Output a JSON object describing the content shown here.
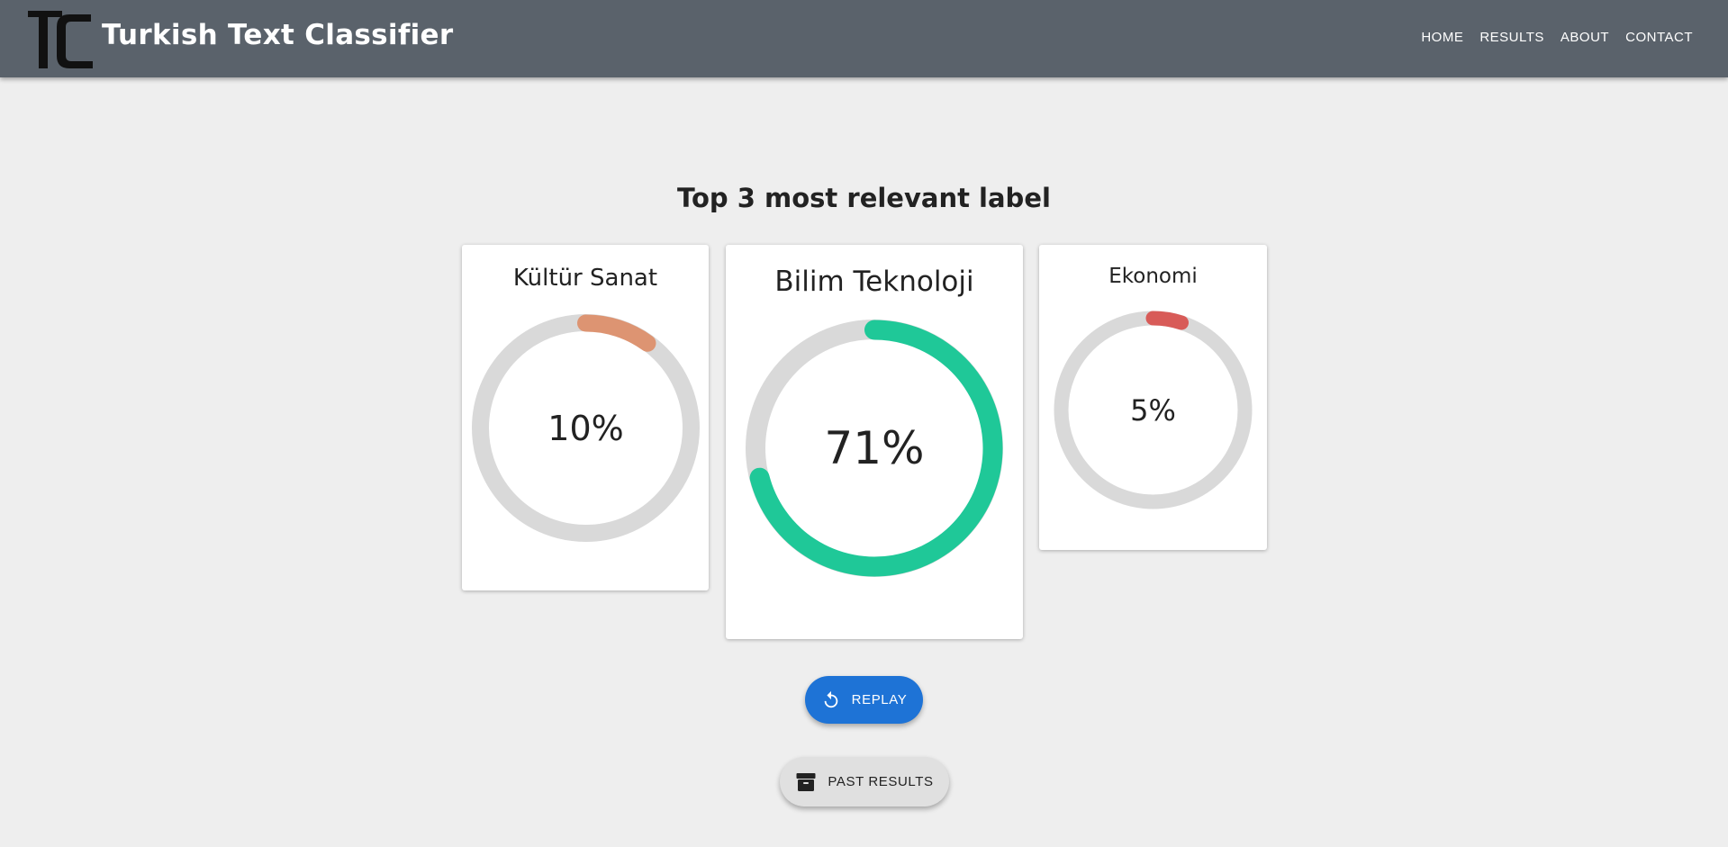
{
  "app": {
    "title": "Turkish Text Classifier",
    "logo_icon": "tc-monogram-icon"
  },
  "nav": {
    "items": [
      {
        "label": "HOME"
      },
      {
        "label": "RESULTS"
      },
      {
        "label": "ABOUT"
      },
      {
        "label": "CONTACT"
      }
    ]
  },
  "main": {
    "heading": "Top 3 most relevant label"
  },
  "results": [
    {
      "label": "Kültür Sanat",
      "value_text": "10%",
      "percent": 10,
      "color": "#dd9472"
    },
    {
      "label": "Bilim Teknoloji",
      "value_text": "71%",
      "percent": 71,
      "color": "#1fc898"
    },
    {
      "label": "Ekonomi",
      "value_text": "5%",
      "percent": 5,
      "color": "#d85b58"
    }
  ],
  "colors": {
    "navbar": "#5a626b",
    "background": "#eeeeee",
    "track": "#d9d9d9",
    "replay_button": "#1e73d6",
    "past_button": "#e0e0e0"
  },
  "actions": {
    "replay_label": "REPLAY",
    "replay_icon": "replay-icon",
    "past_label": "PAST RESULTS",
    "past_icon": "archive-box-icon"
  }
}
